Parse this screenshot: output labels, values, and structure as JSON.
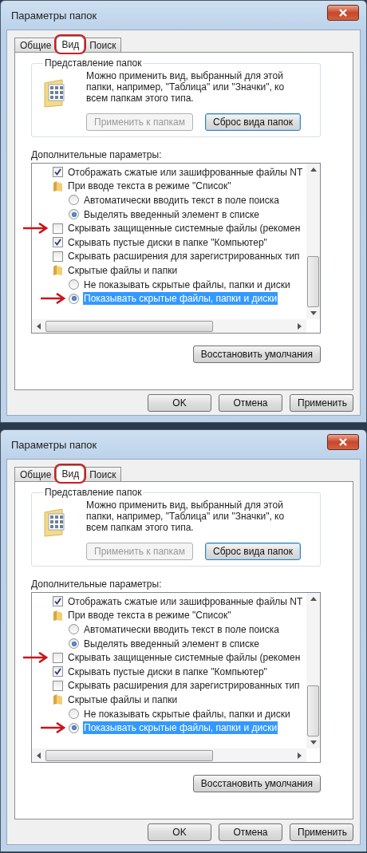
{
  "dialogs": [
    {
      "title": "Параметры папок",
      "tabs": [
        {
          "label": "Общие",
          "selected": false,
          "circled": false
        },
        {
          "label": "Вид",
          "selected": true,
          "circled": true
        },
        {
          "label": "Поиск",
          "selected": false,
          "circled": false
        }
      ],
      "folder_views": {
        "title": "Представление папок",
        "description": "Можно применить вид, выбранный для этой папки, например, \"Таблица\" или \"Значки\", ко всем папкам этого типа.",
        "buttons": [
          {
            "label": "Применить к папкам",
            "disabled": true
          },
          {
            "label": "Сброс вида папок",
            "disabled": false
          }
        ]
      },
      "advanced": {
        "label": "Дополнительные параметры:",
        "items": [
          {
            "kind": "checkbox",
            "label": "Отображать сжатые или зашифрованные файлы NT",
            "checked": true,
            "selected": false,
            "arrow": false
          },
          {
            "kind": "folder",
            "label": "При вводе текста в режиме \"Список\"",
            "selected": false,
            "arrow": false
          },
          {
            "kind": "radio",
            "label": "Автоматически вводить текст в поле поиска",
            "checked": false,
            "selected": false,
            "arrow": false
          },
          {
            "kind": "radio",
            "label": "Выделять введенный элемент в списке",
            "checked": true,
            "selected": false,
            "arrow": false
          },
          {
            "kind": "checkbox",
            "label": "Скрывать защищенные системные файлы (рекомен",
            "checked": false,
            "selected": false,
            "arrow": true
          },
          {
            "kind": "checkbox",
            "label": "Скрывать пустые диски в папке \"Компьютер\"",
            "checked": true,
            "selected": false,
            "arrow": false
          },
          {
            "kind": "checkbox",
            "label": "Скрывать расширения для зарегистрированных тип",
            "checked": false,
            "selected": false,
            "arrow": false
          },
          {
            "kind": "folder",
            "label": "Скрытые файлы и папки",
            "selected": false,
            "arrow": false
          },
          {
            "kind": "radio",
            "label": "Не показывать скрытые файлы, папки и диски",
            "checked": false,
            "selected": false,
            "arrow": false
          },
          {
            "kind": "radio",
            "label": "Показывать скрытые файлы, папки и диски",
            "checked": true,
            "selected": true,
            "arrow": true
          }
        ]
      },
      "restore_button": "Восстановить умолчания",
      "buttons": [
        "OK",
        "Отмена",
        "Применить"
      ]
    },
    {
      "title": "Параметры папок",
      "tabs": [
        {
          "label": "Общие",
          "selected": false,
          "circled": false
        },
        {
          "label": "Вид",
          "selected": true,
          "circled": true
        },
        {
          "label": "Поиск",
          "selected": false,
          "circled": false
        }
      ],
      "folder_views": {
        "title": "Представление папок",
        "description": "Можно применить вид, выбранный для этой папки, например, \"Таблица\" или \"Значки\", ко всем папкам этого типа.",
        "buttons": [
          {
            "label": "Применить к папкам",
            "disabled": true
          },
          {
            "label": "Сброс вида папок",
            "disabled": false
          }
        ]
      },
      "advanced": {
        "label": "Дополнительные параметры:",
        "items": [
          {
            "kind": "checkbox",
            "label": "Отображать сжатые или зашифрованные файлы NT",
            "checked": true,
            "selected": false,
            "arrow": false
          },
          {
            "kind": "folder",
            "label": "При вводе текста в режиме \"Список\"",
            "selected": false,
            "arrow": false
          },
          {
            "kind": "radio",
            "label": "Автоматически вводить текст в поле поиска",
            "checked": false,
            "selected": false,
            "arrow": false
          },
          {
            "kind": "radio",
            "label": "Выделять введенный элемент в списке",
            "checked": true,
            "selected": false,
            "arrow": false
          },
          {
            "kind": "checkbox",
            "label": "Скрывать защищенные системные файлы (рекомен",
            "checked": false,
            "selected": false,
            "arrow": true
          },
          {
            "kind": "checkbox",
            "label": "Скрывать пустые диски в папке \"Компьютер\"",
            "checked": true,
            "selected": false,
            "arrow": false
          },
          {
            "kind": "checkbox",
            "label": "Скрывать расширения для зарегистрированных тип",
            "checked": false,
            "selected": false,
            "arrow": false
          },
          {
            "kind": "folder",
            "label": "Скрытые файлы и папки",
            "selected": false,
            "arrow": false
          },
          {
            "kind": "radio",
            "label": "Не показывать скрытые файлы, папки и диски",
            "checked": false,
            "selected": false,
            "arrow": false
          },
          {
            "kind": "radio",
            "label": "Показывать скрытые файлы, папки и диски",
            "checked": true,
            "selected": true,
            "arrow": true
          }
        ]
      },
      "restore_button": "Восстановить умолчания",
      "buttons": [
        "OK",
        "Отмена",
        "Применить"
      ]
    }
  ]
}
